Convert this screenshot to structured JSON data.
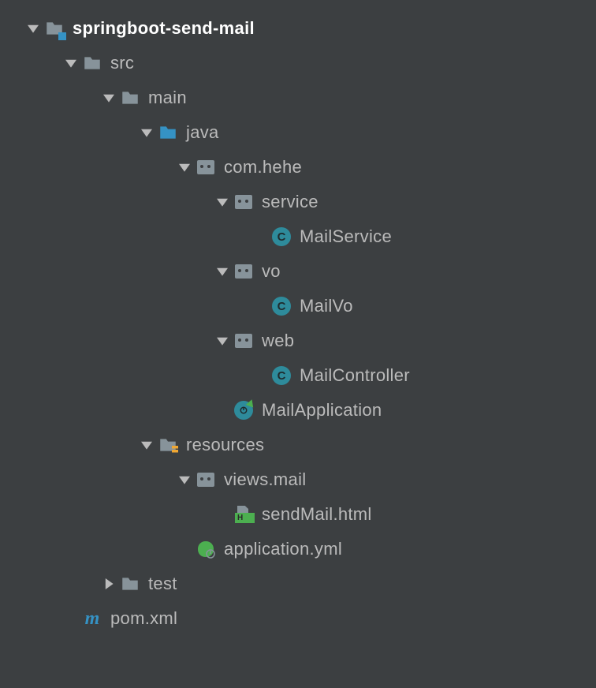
{
  "root": {
    "label": "springboot-send-mail"
  },
  "src": {
    "label": "src"
  },
  "main": {
    "label": "main"
  },
  "java": {
    "label": "java"
  },
  "pkg": {
    "label": "com.hehe"
  },
  "service": {
    "label": "service"
  },
  "mailService": {
    "label": "MailService"
  },
  "vo": {
    "label": "vo"
  },
  "mailVo": {
    "label": "MailVo"
  },
  "web": {
    "label": "web"
  },
  "mailController": {
    "label": "MailController"
  },
  "mailApplication": {
    "label": "MailApplication"
  },
  "resources": {
    "label": "resources"
  },
  "viewsMail": {
    "label": "views.mail"
  },
  "sendMailHtml": {
    "label": "sendMail.html"
  },
  "applicationYml": {
    "label": "application.yml"
  },
  "test": {
    "label": "test"
  },
  "pom": {
    "label": "pom.xml"
  }
}
